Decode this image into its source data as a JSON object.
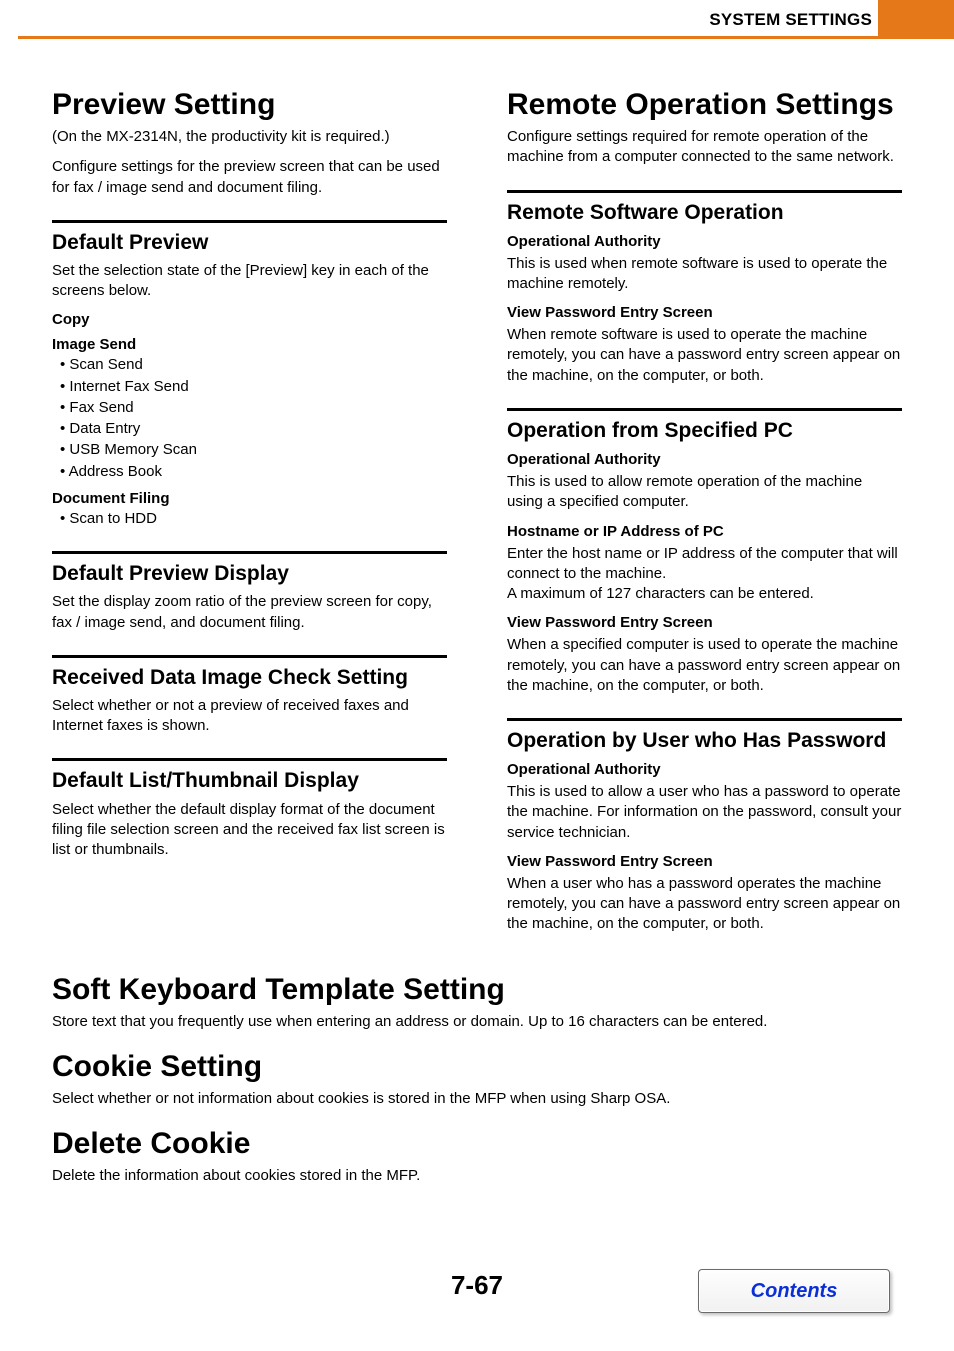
{
  "header": {
    "title": "SYSTEM SETTINGS"
  },
  "left": {
    "preview_setting": {
      "heading": "Preview Setting",
      "note": "(On the MX-2314N, the productivity kit is required.)",
      "body": "Configure settings for the preview screen that can be used for fax / image send and document filing."
    },
    "default_preview": {
      "heading": "Default Preview",
      "body": "Set the selection state of the [Preview] key in each of the screens below.",
      "copy_label": "Copy",
      "image_send_label": "Image Send",
      "image_send_items": [
        "Scan Send",
        "Internet Fax Send",
        "Fax Send",
        "Data Entry",
        "USB Memory Scan",
        "Address Book"
      ],
      "doc_filing_label": "Document Filing",
      "doc_filing_items": [
        "Scan to HDD"
      ]
    },
    "default_preview_display": {
      "heading": "Default Preview Display",
      "body": "Set the display zoom ratio of the preview screen for copy, fax / image send, and document filing."
    },
    "received_data": {
      "heading": "Received Data Image Check Setting",
      "body": "Select whether or not a preview of received faxes and Internet faxes is shown."
    },
    "default_list": {
      "heading": "Default List/Thumbnail Display",
      "body": "Select whether the default display format of the document filing file selection screen and the received fax list screen is list or thumbnails."
    }
  },
  "right": {
    "remote_operation": {
      "heading": "Remote Operation Settings",
      "body": "Configure settings required for remote operation of the machine from a computer connected to the same network."
    },
    "remote_software": {
      "heading": "Remote Software Operation",
      "op_auth_label": "Operational Authority",
      "op_auth_body": "This is used when remote software is used to operate the machine remotely.",
      "view_pw_label": "View Password Entry Screen",
      "view_pw_body": "When remote software is used to operate the machine remotely, you can have a password entry screen appear on the machine, on the computer, or both."
    },
    "specified_pc": {
      "heading": "Operation from Specified PC",
      "op_auth_label": "Operational Authority",
      "op_auth_body": "This is used to allow remote operation of the machine using a specified computer.",
      "hostname_label": "Hostname or IP Address of PC",
      "hostname_body1": "Enter the host name or IP address of the computer that will connect to the machine.",
      "hostname_body2": "A maximum of 127 characters can be entered.",
      "view_pw_label": "View Password Entry Screen",
      "view_pw_body": "When a specified computer is used to operate the machine remotely, you can have a password entry screen appear on the machine, on the computer, or both."
    },
    "user_password": {
      "heading": "Operation by User who Has Password",
      "op_auth_label": "Operational Authority",
      "op_auth_body": "This is used to allow a user who has a password to operate the machine. For information on the password, consult your service technician.",
      "view_pw_label": "View Password Entry Screen",
      "view_pw_body": "When a user who has a password operates the machine remotely, you can have a password entry screen appear on the machine, on the computer, or both."
    }
  },
  "bottom": {
    "soft_keyboard": {
      "heading": "Soft Keyboard Template Setting",
      "body": "Store text that you frequently use when entering an address or domain. Up to 16 characters can be entered."
    },
    "cookie_setting": {
      "heading": "Cookie Setting",
      "body": "Select whether or not information about cookies is stored in the MFP when using Sharp OSA."
    },
    "delete_cookie": {
      "heading": "Delete Cookie",
      "body": "Delete the information about cookies stored in the MFP."
    }
  },
  "footer": {
    "page_number": "7-67",
    "contents_label": "Contents"
  }
}
